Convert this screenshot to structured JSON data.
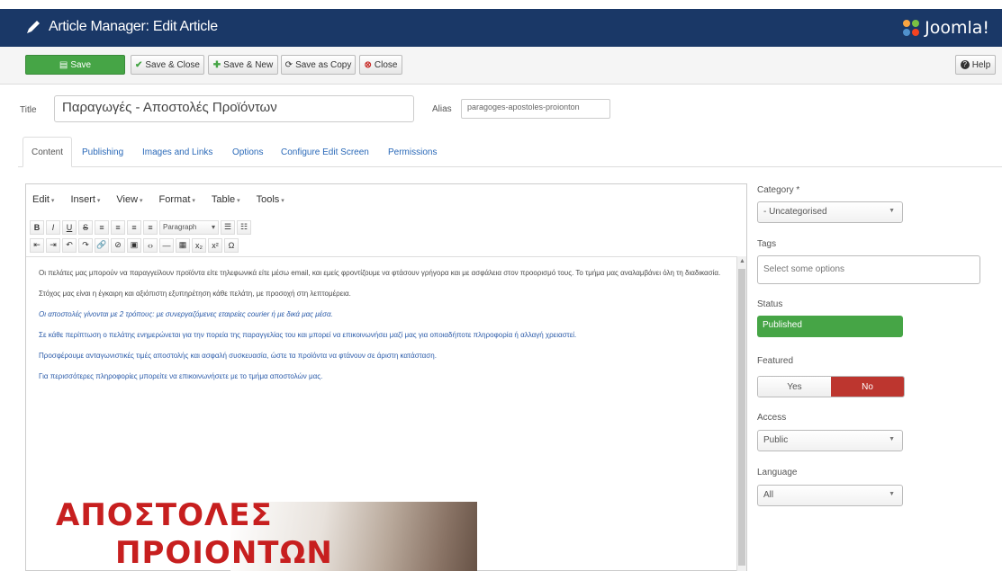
{
  "header": {
    "title": "Article Manager: Edit Article",
    "logo": "Joomla!"
  },
  "toolbar": {
    "save": "Save",
    "save_close": "Save & Close",
    "save_new": "Save & New",
    "save_copy": "Save as Copy",
    "close": "Close",
    "help": "Help"
  },
  "form": {
    "title_label": "Title",
    "title_value": "Παραγωγές - Αποστολές Προϊόντων",
    "alias_label": "Alias",
    "alias_value": "paragoges-apostoles-proionton"
  },
  "tabs": [
    {
      "label": "Content"
    },
    {
      "label": "Publishing"
    },
    {
      "label": "Images and Links"
    },
    {
      "label": "Options"
    },
    {
      "label": "Configure Edit Screen"
    },
    {
      "label": "Permissions"
    }
  ],
  "editor": {
    "menus": [
      "Edit",
      "Insert",
      "View",
      "Format",
      "Table",
      "Tools"
    ],
    "format_select": "Paragraph",
    "paragraphs": [
      "Οι πελάτες μας μπορούν να παραγγείλουν προϊόντα είτε τηλεφωνικά είτε μέσω email, και εμείς φροντίζουμε να φτάσουν γρήγορα και με ασφάλεια στον προορισμό τους. Το τμήμα μας αναλαμβάνει όλη τη διαδικασία.",
      "Στόχος μας είναι η έγκαιρη και αξιόπιστη εξυπηρέτηση κάθε πελάτη, με προσοχή στη λεπτομέρεια.",
      "Οι αποστολές γίνονται με 2 τρόπους: με συνεργαζόμενες εταιρείες courier ή με δικά μας μέσα.",
      "Σε κάθε περίπτωση ο πελάτης ενημερώνεται για την πορεία της παραγγελίας του και μπορεί να επικοινωνήσει μαζί μας για οποιαδήποτε πληροφορία ή αλλαγή χρειαστεί.",
      "Προσφέρουμε ανταγωνιστικές τιμές αποστολής και ασφαλή συσκευασία, ώστε τα προϊόντα να φτάνουν σε άριστη κατάσταση.",
      "Για περισσότερες πληροφορίες μπορείτε να επικοινωνήσετε με το τμήμα αποστολών μας."
    ],
    "promo_line1": "ΑΠΟΣΤΟΛΕΣ",
    "promo_line2": "ΠΡΟΙΟΝΤΩΝ"
  },
  "sidebar": {
    "category_label": "Category *",
    "category_value": "- Uncategorised",
    "tags_label": "Tags",
    "tags_placeholder": "Select some options",
    "status_label": "Status",
    "status_value": "Published",
    "featured_label": "Featured",
    "featured_yes": "Yes",
    "featured_no": "No",
    "access_label": "Access",
    "access_value": "Public",
    "language_label": "Language",
    "language_value": "All"
  },
  "colors": {
    "header_bg": "#1a3867",
    "save_green": "#46a546",
    "published_green": "#46a546",
    "no_red": "#bd362f",
    "promo_red": "#c71f1f"
  }
}
